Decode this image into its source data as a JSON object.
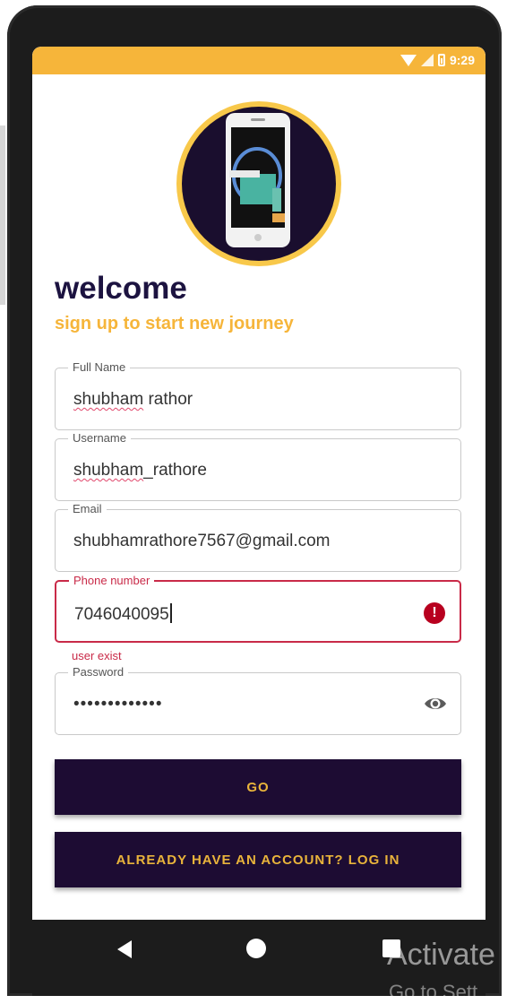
{
  "status_bar": {
    "time": "9:29"
  },
  "header": {
    "title": "welcome",
    "subtitle": "sign up to start new journey"
  },
  "form": {
    "full_name": {
      "label": "Full Name",
      "value_first": "shubham",
      "value_rest": " rathor"
    },
    "username": {
      "label": "Username",
      "value_first": "shubham",
      "value_rest": "_rathore"
    },
    "email": {
      "label": "Email",
      "value": "shubhamrathore7567@gmail.com"
    },
    "phone": {
      "label": "Phone number",
      "value": "7046040095",
      "error": "user exist"
    },
    "password": {
      "label": "Password",
      "masked_value": "•••••••••••••"
    }
  },
  "buttons": {
    "go": "GO",
    "login": "ALREADY HAVE AN ACCOUNT? LOG IN"
  },
  "watermark": {
    "line1": "Activate",
    "line2": "Go to Sett"
  },
  "colors": {
    "accent": "#f6b53a",
    "primary_dark": "#1d0c33",
    "error": "#c92a48"
  },
  "icons": [
    "wifi-icon",
    "signal-icon",
    "battery-icon",
    "app-logo",
    "error-icon",
    "eye-icon",
    "back-icon",
    "home-icon",
    "recents-icon"
  ]
}
